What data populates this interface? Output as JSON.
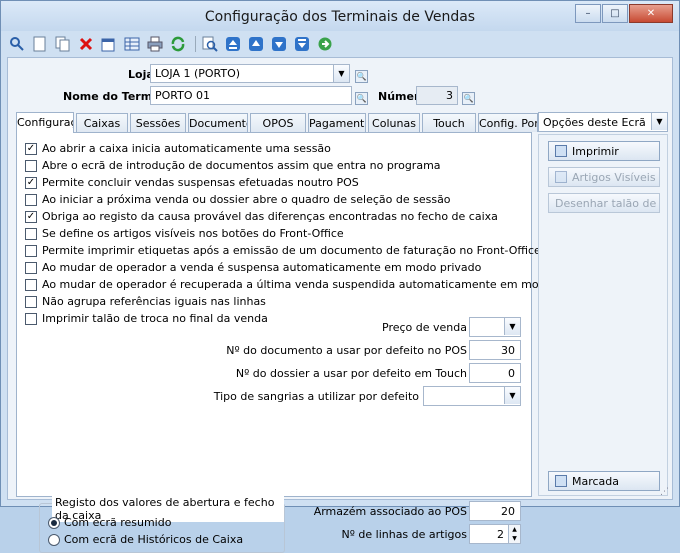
{
  "window": {
    "title": "Configuração dos Terminais de Vendas"
  },
  "titlebar_buttons": {
    "minimize": "–",
    "maximize": "□",
    "close": "✕"
  },
  "toolbar": {
    "icons": [
      "search-icon",
      "new-document-icon",
      "copy-icon",
      "delete-icon",
      "properties-icon",
      "grid-icon",
      "printer-icon",
      "refresh-icon",
      "zoom-icon",
      "first-icon",
      "previous-icon",
      "next-icon",
      "last-icon",
      "exit-icon"
    ]
  },
  "header": {
    "loja_label": "Loja",
    "loja_value": "LOJA 1 (PORTO)",
    "terminal_label": "Nome do Terminal",
    "terminal_value": "PORTO 01",
    "numero_label": "Número",
    "numero_value": "3"
  },
  "tabs": [
    {
      "label": "Configuraç",
      "active": true
    },
    {
      "label": "Caixas"
    },
    {
      "label": "Sessões"
    },
    {
      "label": "Documento"
    },
    {
      "label": "OPOS"
    },
    {
      "label": "Pagamento"
    },
    {
      "label": "Colunas"
    },
    {
      "label": "Touch"
    },
    {
      "label": "Config. Port"
    }
  ],
  "options": [
    {
      "label": "Ao abrir a caixa inicia automaticamente uma sessão",
      "checked": true
    },
    {
      "label": "Abre o ecrã de introdução de documentos assim que entra no programa",
      "checked": false
    },
    {
      "label": "Permite concluir vendas suspensas efetuadas noutro POS",
      "checked": true
    },
    {
      "label": "Ao iniciar a próxima venda ou dossier abre o quadro de seleção de sessão",
      "checked": false
    },
    {
      "label": "Obriga ao registo da causa provável das diferenças encontradas no fecho de caixa",
      "checked": true
    },
    {
      "label": "Se define os artigos visíveis nos botões do Front-Office",
      "checked": false
    },
    {
      "label": "Permite imprimir etiquetas após a emissão de um documento de faturação no Front-Office",
      "checked": false
    },
    {
      "label": "Ao mudar de operador a venda é suspensa automaticamente em modo privado",
      "checked": false
    },
    {
      "label": "Ao mudar de operador é recuperada a última venda suspendida automaticamente em modo privado",
      "checked": false
    },
    {
      "label": "Não agrupa referências iguais nas linhas",
      "checked": false
    },
    {
      "label": "Imprimir talão de troca no final da venda",
      "checked": false
    }
  ],
  "fields": {
    "preco_label": "Preço de venda",
    "preco_value": "",
    "doc_label": "Nº do documento a usar por defeito no POS",
    "doc_value": "30",
    "dossier_label": "Nº do dossier a usar por defeito em Touch",
    "dossier_value": "0",
    "sangrias_label": "Tipo de sangrias a utilizar por defeito",
    "sangrias_value": "",
    "armazem_label": "Armazém associado ao POS",
    "armazem_value": "20",
    "linhas_label": "Nº de linhas de artigos",
    "linhas_value": "2"
  },
  "registo": {
    "title": "Registo dos valores de abertura e fecho da caixa",
    "option1": "Com ecrã resumido",
    "option2": "Com ecrã de Históricos de Caixa",
    "selected": 1
  },
  "side": {
    "header": "Opções deste Ecrã",
    "imprimir": "Imprimir",
    "artigos": "Artigos Visíveis",
    "desenhar": "Desenhar talão de troca",
    "marcada": "Marcada"
  }
}
